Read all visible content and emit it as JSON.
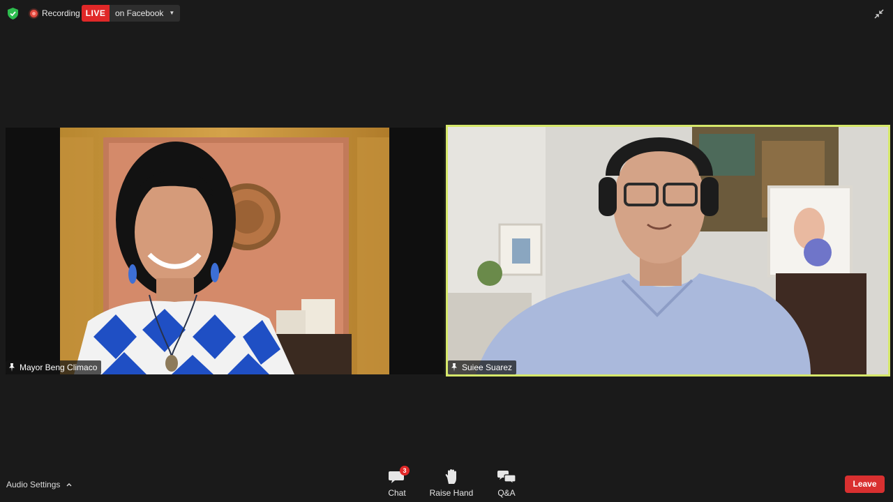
{
  "top_bar": {
    "recording_label": "Recording",
    "live_label": "LIVE",
    "live_target": "on Facebook"
  },
  "participants": [
    {
      "name": "Mayor Beng Climaco",
      "pinned": true,
      "active_speaker": false
    },
    {
      "name": "Suiee Suarez",
      "pinned": true,
      "active_speaker": true
    }
  ],
  "bottom_bar": {
    "audio_settings_label": "Audio Settings",
    "chat_label": "Chat",
    "chat_unread_count": "3",
    "raise_hand_label": "Raise Hand",
    "qa_label": "Q&A",
    "leave_label": "Leave"
  },
  "colors": {
    "background": "#1a1a1a",
    "live_red": "#e02828",
    "leave_red": "#d93030",
    "active_speaker_border": "#d6e86a",
    "security_green": "#2dbd4e"
  },
  "icons": [
    "shield-check-icon",
    "record-dot-icon",
    "caret-down-icon",
    "collapse-icon",
    "pin-icon",
    "chevron-up-icon",
    "chat-icon",
    "raise-hand-icon",
    "qa-icon"
  ]
}
